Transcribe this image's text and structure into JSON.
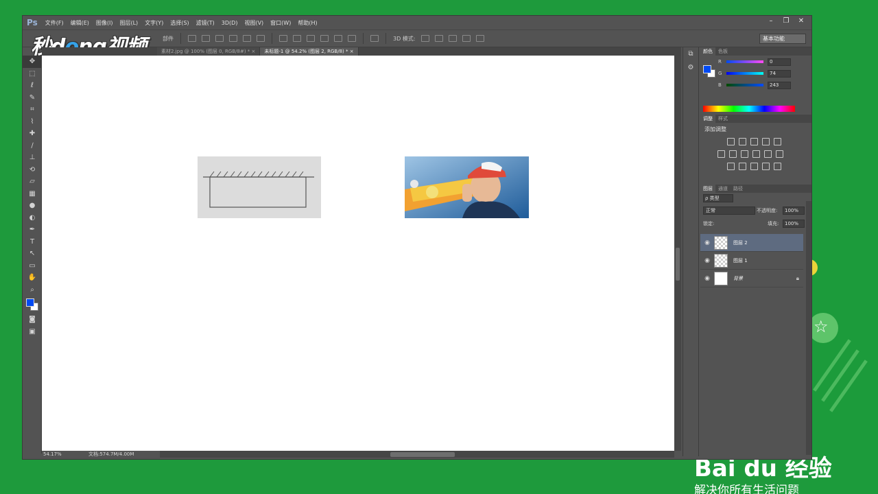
{
  "window": {
    "app_logo": "Ps",
    "menu": [
      "文件(F)",
      "编辑(E)",
      "图像(I)",
      "图层(L)",
      "文字(Y)",
      "选择(S)",
      "滤镜(T)",
      "3D(D)",
      "视图(V)",
      "窗口(W)",
      "帮助(H)"
    ],
    "controls": {
      "minimize": "–",
      "restore": "❐",
      "close": "✕"
    }
  },
  "watermark": {
    "pre": "秒d",
    "o": "o",
    "post": "ng视频"
  },
  "options_bar": {
    "parts_label": "部件",
    "label_3d": "3D 模式:",
    "workspace": "基本功能"
  },
  "tabs": [
    {
      "label": "素材2.jpg @ 100% (图层 0, RGB/8#) *",
      "active": false
    },
    {
      "label": "未标题-1 @ 54.2% (图层 2, RGB/8) *",
      "active": true
    }
  ],
  "status": {
    "zoom": "54.17%",
    "doc": "文档:574.7M/4.00M"
  },
  "panels": {
    "color_tabs": [
      "颜色",
      "色板"
    ],
    "rgb": [
      {
        "label": "R",
        "value": "0"
      },
      {
        "label": "G",
        "value": "74"
      },
      {
        "label": "B",
        "value": "243"
      }
    ],
    "adjust_tabs": [
      "调整",
      "样式"
    ],
    "adjust_title": "添加调整",
    "layers_tabs": [
      "图层",
      "通道",
      "路径"
    ],
    "filter_kind": "ρ 类型",
    "blend_mode": "正常",
    "opacity_label": "不透明度:",
    "opacity_value": "100%",
    "lock_label": "锁定:",
    "fill_label": "填充:",
    "fill_value": "100%",
    "layers": [
      {
        "name": "图层 2",
        "selected": true,
        "thumb": "checker"
      },
      {
        "name": "图层 1",
        "selected": false,
        "thumb": "checker"
      },
      {
        "name": "背景",
        "selected": false,
        "thumb": "white",
        "locked": true
      }
    ]
  },
  "colors": {
    "foreground": "#004af3",
    "background": "#ffffff"
  },
  "overlay": {
    "brand": "Bai du 经验",
    "slogan": "解决你所有生活问题"
  }
}
